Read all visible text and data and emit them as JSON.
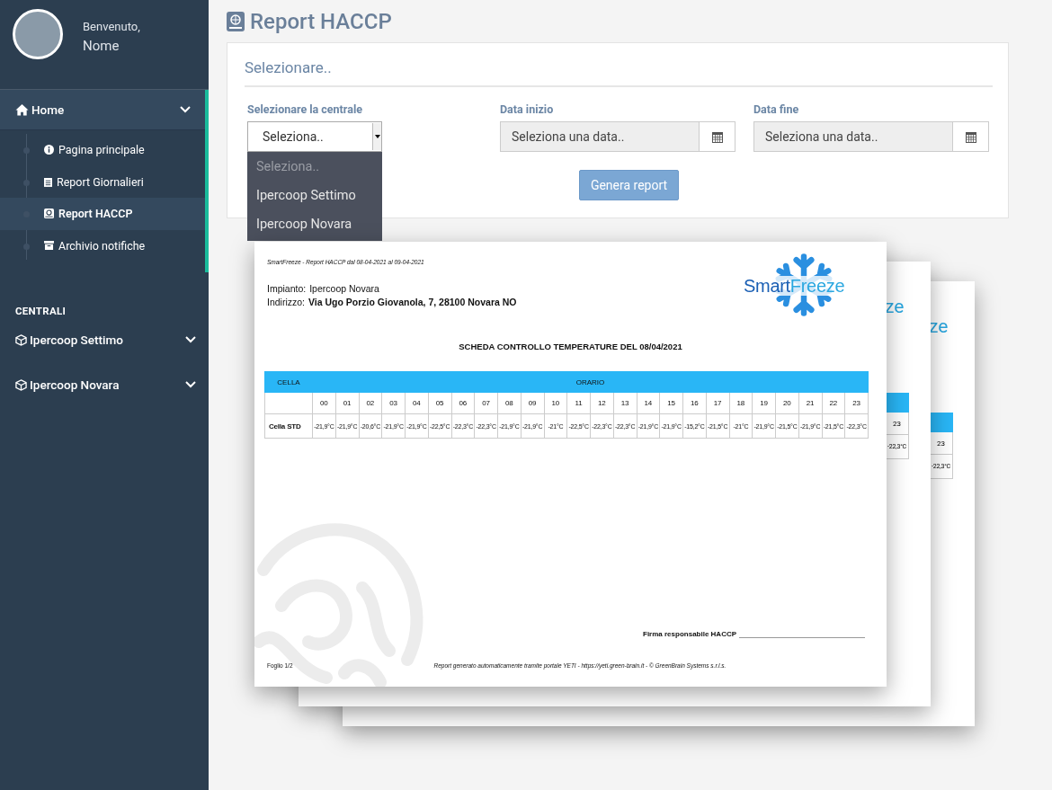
{
  "user": {
    "greeting": "Benvenuto,",
    "name": "Nome"
  },
  "menu": {
    "label": "Home",
    "expanded": true,
    "items": [
      {
        "label": "Pagina principale",
        "selected": false
      },
      {
        "label": "Report Giornalieri",
        "selected": false
      },
      {
        "label": "Report HACCP",
        "selected": true
      },
      {
        "label": "Archivio notifiche",
        "selected": false
      }
    ]
  },
  "section_title": "CENTRALI",
  "centrali": [
    {
      "label": "Ipercoop Settimo",
      "expanded": false
    },
    {
      "label": "Ipercoop Novara",
      "expanded": false
    }
  ],
  "page_title": "Report HACCP",
  "card": {
    "title": "Selezionare..",
    "select": {
      "label": "Selezionare la centrale",
      "value": "Seleziona..",
      "open": true,
      "options": [
        {
          "label": "Seleziona..",
          "placeholder": true
        },
        {
          "label": "Ipercoop Settimo",
          "placeholder": false
        },
        {
          "label": "Ipercoop Novara",
          "placeholder": false
        }
      ]
    },
    "dates": [
      {
        "label": "Data inizio",
        "placeholder": "Seleziona una data.."
      },
      {
        "label": "Data fine",
        "placeholder": "Seleziona una data.."
      }
    ],
    "button": "Genera report"
  },
  "report": {
    "header": "SmartFreeze - Report HACCP dal 08-04-2021 al 09-04-2021",
    "logo": [
      "Smart",
      "Freeze"
    ],
    "plant_label": "Impianto:",
    "plant": "Ipercoop Novara",
    "address_label": "Indirizzo:",
    "address": "Via Ugo Porzio Giovanola, 7, 28100 Novara NO",
    "title": "SCHEDA CONTROLLO TEMPERATURE DEL 08/04/2021",
    "col_cell": "CELLA",
    "col_time": "ORARIO",
    "hours": [
      "00",
      "01",
      "02",
      "03",
      "04",
      "05",
      "06",
      "07",
      "08",
      "09",
      "10",
      "11",
      "12",
      "13",
      "14",
      "15",
      "16",
      "17",
      "18",
      "19",
      "20",
      "21",
      "22",
      "23"
    ],
    "rows": [
      {
        "name": "Cella STD",
        "values": [
          "-21,9°C",
          "-21,9°C",
          "-20,6°C",
          "-21,9°C",
          "-21,9°C",
          "-22,5°C",
          "-22,3°C",
          "-22,3°C",
          "-21,9°C",
          "-21,9°C",
          "-21°C",
          "-22,5°C",
          "-22,3°C",
          "-22,3°C",
          "-21,9°C",
          "-21,9°C",
          "-15,2°C",
          "-21,5°C",
          "-21°C",
          "-21,9°C",
          "-21,5°C",
          "-21,9°C",
          "-21,5°C",
          "-22,3°C"
        ]
      }
    ],
    "signature": "Firma responsabile HACCP",
    "page_number": "Foglio 1/2",
    "footer": "Report generato automaticamente tramite portale YETI - https://yeti.green-brain.it - © GreenBrain Systems s.r.l.s."
  },
  "back_pages": [
    {
      "logo_fragment": "ze",
      "hour": "23",
      "value": "-22,3°C"
    },
    {
      "logo_fragment": "ze",
      "hour": "23",
      "value": "-22,3°C"
    }
  ]
}
